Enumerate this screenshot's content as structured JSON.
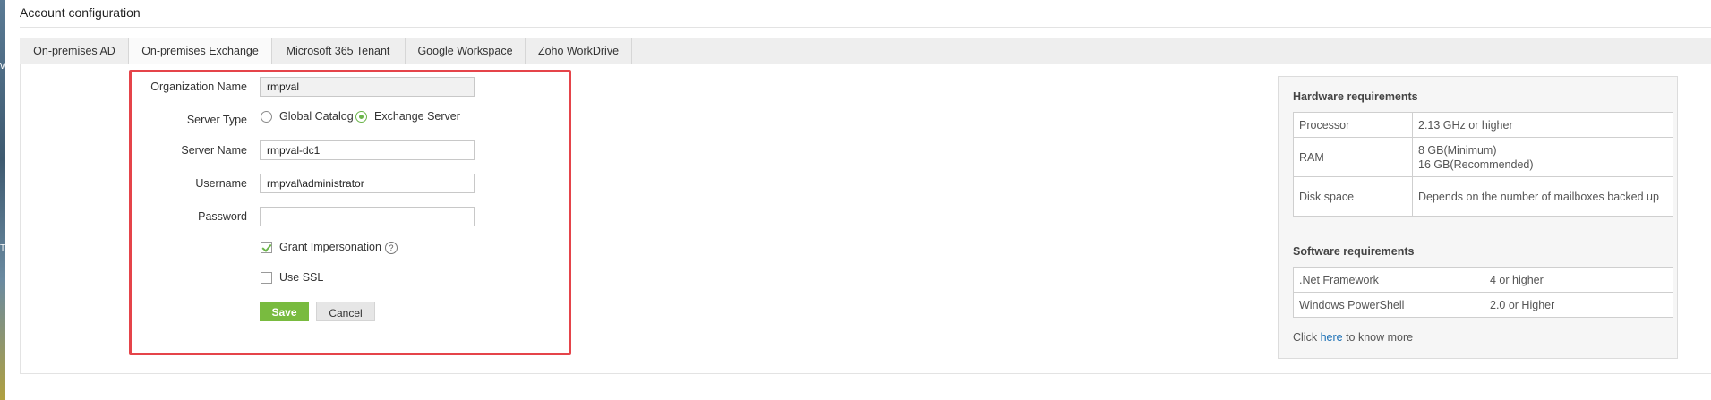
{
  "page": {
    "title": "Account configuration"
  },
  "tabs": [
    {
      "label": "On-premises AD"
    },
    {
      "label": "On-premises Exchange",
      "active": true
    },
    {
      "label": "Microsoft 365 Tenant"
    },
    {
      "label": "Google Workspace"
    },
    {
      "label": "Zoho WorkDrive"
    }
  ],
  "form": {
    "org_name_label": "Organization Name",
    "org_name_value": "rmpval",
    "server_type_label": "Server Type",
    "server_type_options": [
      "Global Catalog",
      "Exchange Server"
    ],
    "server_type_selected": "Exchange Server",
    "server_name_label": "Server Name",
    "server_name_value": "rmpval-dc1",
    "username_label": "Username",
    "username_value": "rmpval\\administrator",
    "password_label": "Password",
    "password_value": "",
    "grant_impersonation_label": "Grant Impersonation",
    "grant_impersonation_checked": true,
    "use_ssl_label": "Use SSL",
    "use_ssl_checked": false,
    "help_glyph": "?",
    "save_label": "Save",
    "cancel_label": "Cancel"
  },
  "requirements": {
    "hardware_heading": "Hardware requirements",
    "hardware": [
      {
        "name": "Processor",
        "value": "2.13 GHz or higher"
      },
      {
        "name": "RAM",
        "value_line1": "8 GB(Minimum)",
        "value_line2": "16 GB(Recommended)"
      },
      {
        "name": "Disk space",
        "value": "Depends on the number of mailboxes backed up"
      }
    ],
    "software_heading": "Software requirements",
    "software": [
      {
        "name": ".Net Framework",
        "value": "4 or higher"
      },
      {
        "name": "Windows PowerShell",
        "value": "2.0 or Higher"
      }
    ],
    "more_prefix": "Click ",
    "more_link": "here",
    "more_suffix": " to know more"
  },
  "colors": {
    "accent_green": "#79bb3f",
    "highlight_red": "#e5444a",
    "link_blue": "#1a6fb5"
  },
  "edge_glyphs": [
    "W",
    "T"
  ]
}
